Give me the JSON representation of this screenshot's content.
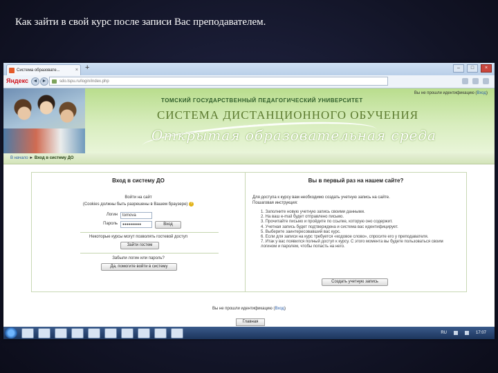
{
  "slide_title": "Как зайти в свой курс после записи Вас преподавателем.",
  "browser": {
    "tab_title": "Система образовате...",
    "tab_close": "×",
    "new_tab": "+",
    "window_controls": [
      "–",
      "□",
      "×"
    ],
    "search_brand": "Яндекс",
    "url": "sdo.tspu.ru/login/index.php"
  },
  "header": {
    "login_status_prefix": "Вы не прошли идентификацию (",
    "login_link": "Вход",
    "login_status_suffix": ")",
    "university": "ТОМСКИЙ ГОСУДАРСТВЕННЫЙ ПЕДАГОГИЧЕСКИЙ УНИВЕРСИТЕТ",
    "system_name": "СИСТЕМА ДИСТАНЦИОННОГО ОБУЧЕНИЯ",
    "tagline": "Открытая образовательная среда"
  },
  "breadcrumb": {
    "home": "В начало",
    "separator": "►",
    "current": "Вход в систему ДО"
  },
  "login_panel": {
    "heading": "Вход в систему ДО",
    "prompt": "Войти на сайт",
    "cookies_note": "(Cookies должны быть разрешены в Вашем браузере)",
    "help_icon": "?",
    "login_label": "Логин",
    "login_value": "tomova",
    "password_label": "Пароль",
    "password_value": "●●●●●●●●●",
    "submit_label": "Вход",
    "guest_note": "Некоторые курсы могут позволять гостевой доступ",
    "guest_button": "Зайти гостем",
    "forgot_question": "Забыли логин или пароль?",
    "forgot_button": "Да, помогите войти в систему"
  },
  "signup_panel": {
    "heading": "Вы в первый раз на нашем сайте?",
    "intro1": "Для доступа к курсу вам необходимо создать учетную запись на сайте.",
    "intro2": "Пошаговая инструкция:",
    "steps": [
      "1. Заполните новую учетную запись своими данными.",
      "2. На ваш e-mail будет отправлено письмо.",
      "3. Прочитайте письмо и пройдите по ссылке, которую оно содержит.",
      "4. Учетная запись будет подтверждена и система вас идентифицирует.",
      "5. Выберите заинтересовавший вас курс.",
      "6. Если для записи на курс требуется «кодовое слово», спросите его у преподавателя.",
      "7. Итак у вас появился полный доступ к курсу. С этого момента вы будете пользоваться своим логином и паролем, чтобы попасть на него."
    ],
    "create_button": "Создать учетную запись"
  },
  "home_button": "Главная",
  "taskbar": {
    "lang": "RU",
    "time": "17:07"
  }
}
